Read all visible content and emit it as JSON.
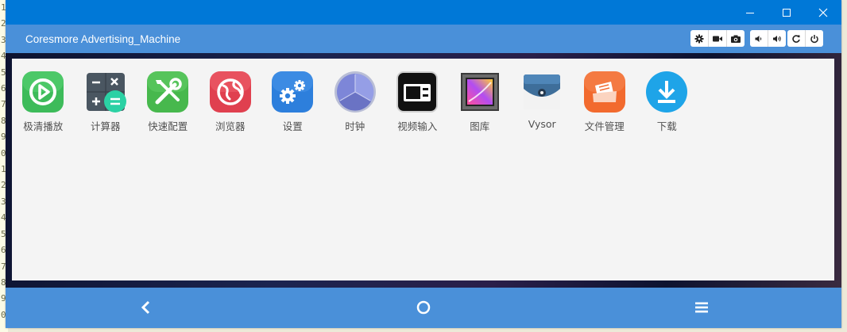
{
  "window": {
    "title": "Coresmore Advertising_Machine",
    "controls": [
      "minimize-icon",
      "maximize-icon",
      "close-icon"
    ]
  },
  "toolbar": {
    "groups": [
      [
        "gear-icon",
        "video-camera-icon",
        "camera-icon"
      ],
      [
        "volume-down-icon",
        "volume-up-icon"
      ],
      [
        "rotate-icon",
        "power-icon"
      ]
    ]
  },
  "apps": [
    {
      "label": "极清播放",
      "icon": "video-player-icon"
    },
    {
      "label": "计算器",
      "icon": "calculator-icon"
    },
    {
      "label": "快速配置",
      "icon": "tools-icon"
    },
    {
      "label": "浏览器",
      "icon": "browser-globe-icon"
    },
    {
      "label": "设置",
      "icon": "settings-gears-icon"
    },
    {
      "label": "时钟",
      "icon": "clock-icon"
    },
    {
      "label": "视频输入",
      "icon": "video-input-icon"
    },
    {
      "label": "图库",
      "icon": "gallery-icon"
    },
    {
      "label": "Vysor",
      "icon": "vysor-icon"
    },
    {
      "label": "文件管理",
      "icon": "file-manager-icon"
    },
    {
      "label": "下载",
      "icon": "download-icon"
    }
  ],
  "navbar": {
    "buttons": [
      "back-icon",
      "home-icon",
      "menu-icon"
    ]
  },
  "background_editor": {
    "line_numbers": [
      "1",
      "2",
      "3",
      "4",
      "5",
      "6",
      "7",
      "8",
      "9",
      "0",
      "1",
      "2",
      "3",
      "4",
      "5",
      "6",
      "7",
      "8",
      "9",
      "0"
    ]
  },
  "colors": {
    "titlebar": "#0078d7",
    "appbar": "#4a90d9",
    "screen": "#f4f4f4"
  }
}
